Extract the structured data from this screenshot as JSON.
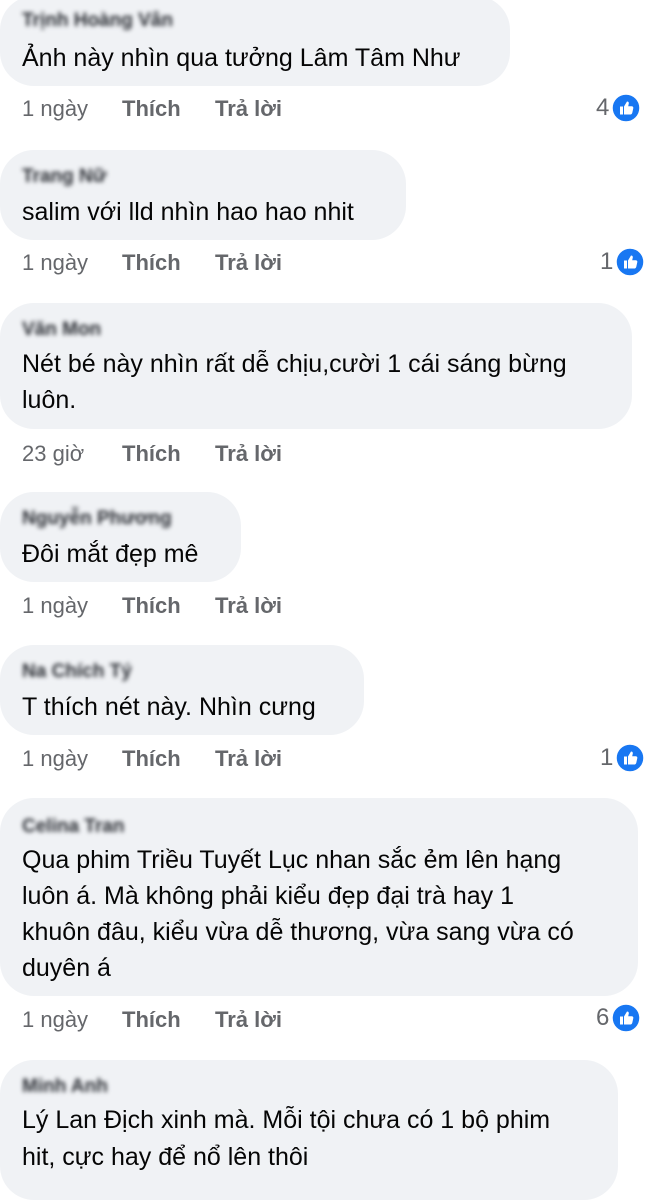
{
  "comments": [
    {
      "author": "Trịnh Hoàng Vân",
      "text_lines": [
        "Ảnh này nhìn qua tưởng Lâm Tâm Như"
      ],
      "time": "1 ngày",
      "like_label": "Thích",
      "reply_label": "Trả lời",
      "reactions": "4"
    },
    {
      "author": "Trang Nữ",
      "text_lines": [
        "salim với lld nhìn hao hao nhit"
      ],
      "time": "1 ngày",
      "like_label": "Thích",
      "reply_label": "Trả lời",
      "reactions": "1"
    },
    {
      "author": "Văn Mon",
      "text_lines": [
        "Nét bé này nhìn rất dễ chịu,cười 1 cái sáng bừng",
        "luôn."
      ],
      "time": "23 giờ",
      "like_label": "Thích",
      "reply_label": "Trả lời",
      "reactions": ""
    },
    {
      "author": "Nguyễn Phương",
      "text_lines": [
        "Đôi mắt đẹp mê"
      ],
      "time": "1 ngày",
      "like_label": "Thích",
      "reply_label": "Trả lời",
      "reactions": ""
    },
    {
      "author": "Na Chích Tý",
      "text_lines": [
        "T thích nét này. Nhìn cưng"
      ],
      "time": "1 ngày",
      "like_label": "Thích",
      "reply_label": "Trả lời",
      "reactions": "1"
    },
    {
      "author": "Celina Tran",
      "text_lines": [
        "Qua phim Triều Tuyết Lục nhan sắc ẻm lên hạng",
        "luôn á. Mà không phải kiểu đẹp đại trà hay 1",
        "khuôn đâu, kiểu vừa dễ thương, vừa sang vừa có",
        "duyên á"
      ],
      "time": "1 ngày",
      "like_label": "Thích",
      "reply_label": "Trả lời",
      "reactions": "6"
    },
    {
      "author": "Minh Anh",
      "text_lines": [
        "Lý Lan Địch xinh mà. Mỗi tội chưa có 1 bộ phim",
        "hit, cực hay để nổ lên thôi"
      ],
      "time": "",
      "like_label": "",
      "reply_label": "",
      "reactions": ""
    }
  ],
  "colors": {
    "bubble": "#f0f2f5",
    "meta_text": "#65676b",
    "like_blue": "#1877f2"
  },
  "icons": {
    "reaction": "like-thumb-icon"
  }
}
